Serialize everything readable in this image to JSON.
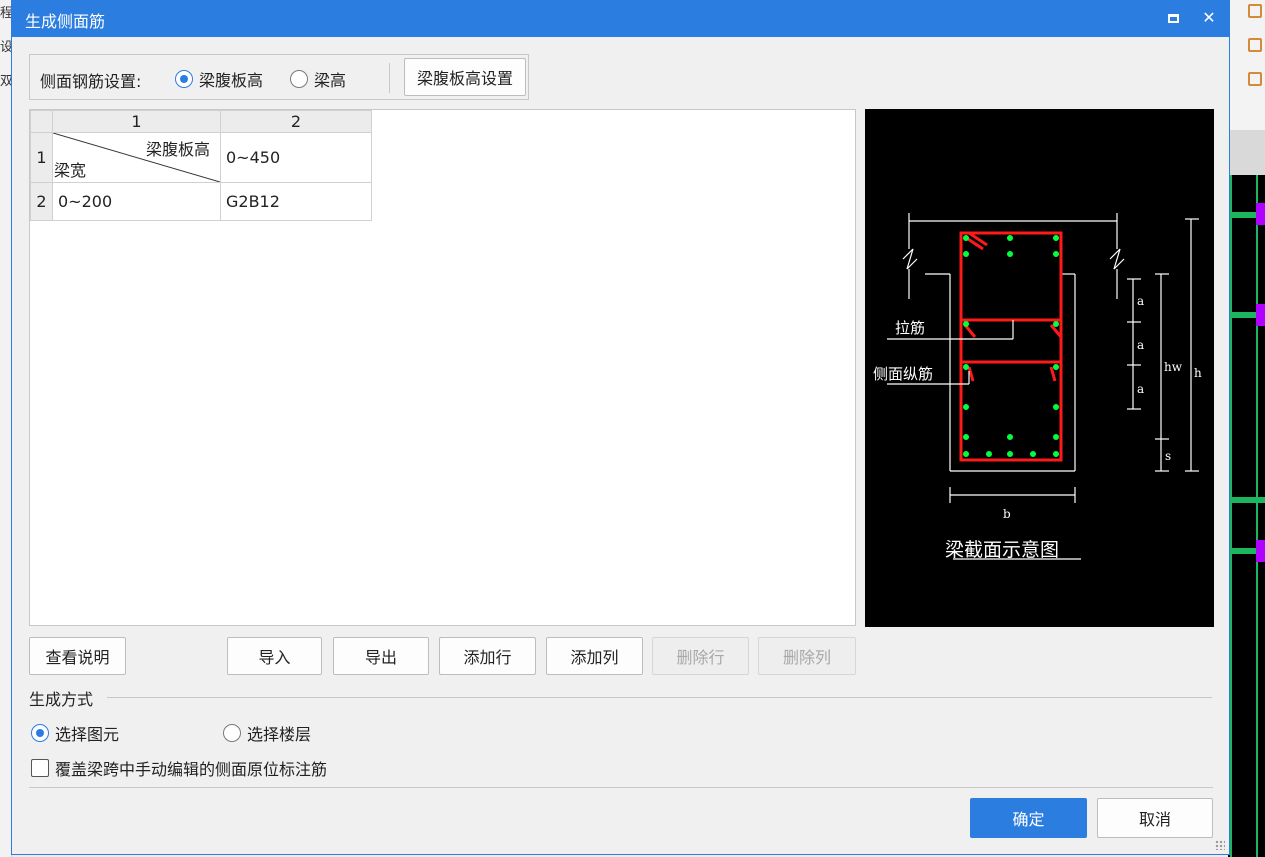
{
  "dialog": {
    "title": "生成侧面筋",
    "maximize_label": "",
    "close_label": "✕"
  },
  "settings": {
    "label": "侧面钢筋设置:",
    "options": [
      {
        "label": "梁腹板高",
        "selected": true
      },
      {
        "label": "梁高",
        "selected": false
      }
    ],
    "config_button": "梁腹板高设置"
  },
  "grid": {
    "col_headers": [
      "1",
      "2"
    ],
    "row_headers": [
      "1",
      "2"
    ],
    "corner_top_right": "梁腹板高",
    "corner_bottom_left": "梁宽",
    "header_value": "0~450",
    "row_label": "0~200",
    "row_value": "G2B12"
  },
  "diagram": {
    "caption": "梁截面示意图",
    "label_tie": "拉筋",
    "label_side": "侧面纵筋",
    "dim_a": "a",
    "dim_hw": "hw",
    "dim_h": "h",
    "dim_s": "s",
    "dim_b": "b",
    "colors": {
      "bar": "#ff1a1a",
      "dot": "#00ff3c",
      "line": "#ffffff"
    }
  },
  "actions": {
    "help": "查看说明",
    "import": "导入",
    "export": "导出",
    "add_row": "添加行",
    "add_col": "添加列",
    "del_row": "删除行",
    "del_col": "删除列"
  },
  "generate": {
    "section_title": "生成方式",
    "options": [
      {
        "label": "选择图元",
        "selected": true
      },
      {
        "label": "选择楼层",
        "selected": false
      }
    ],
    "override_label": "覆盖梁跨中手动编辑的侧面原位标注筋",
    "override_checked": false
  },
  "footer": {
    "ok": "确定",
    "cancel": "取消"
  },
  "background": {
    "left_fragments": [
      "程",
      "设",
      "双"
    ]
  }
}
